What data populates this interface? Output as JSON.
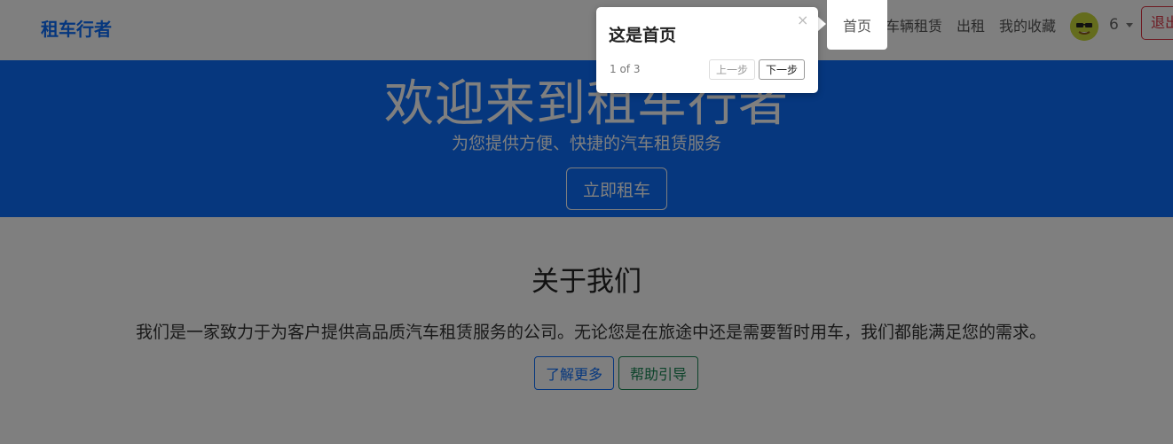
{
  "navbar": {
    "brand": "租车行者",
    "items": [
      {
        "label": "首页"
      },
      {
        "label": "车辆租赁"
      },
      {
        "label": "出租"
      },
      {
        "label": "我的收藏"
      }
    ],
    "user_count": "6",
    "logout_label": "退出"
  },
  "hero": {
    "title": "欢迎来到租车行者",
    "subtitle": "为您提供方便、快捷的汽车租赁服务",
    "cta_label": "立即租车"
  },
  "about": {
    "title": "关于我们",
    "text": "我们是一家致力于为客户提供高品质汽车租赁服务的公司。无论您是在旅途中还是需要暂时用车，我们都能满足您的需求。",
    "learn_more_label": "了解更多",
    "help_guide_label": "帮助引导"
  },
  "tour": {
    "title": "这是首页",
    "progress": "1 of 3",
    "prev_label": "上一步",
    "next_label": "下一步",
    "close_symbol": "×"
  },
  "colors": {
    "primary": "#0d6efd",
    "success": "#198754",
    "danger": "#dc3545"
  }
}
